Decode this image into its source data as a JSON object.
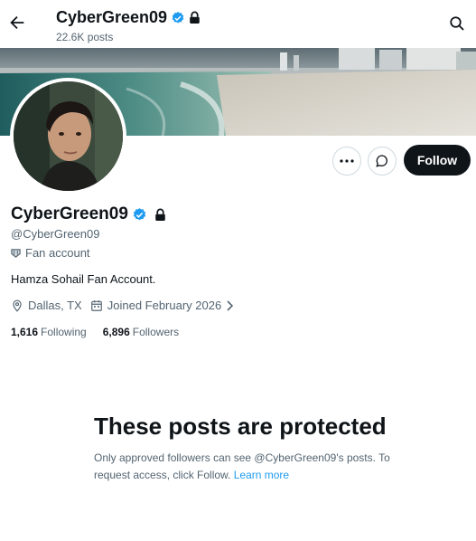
{
  "header": {
    "name": "CyberGreen09",
    "post_count": "22.6K posts"
  },
  "profile": {
    "display_name": "CyberGreen09",
    "handle": "@CyberGreen09",
    "label": "Fan account",
    "bio": "Hamza Sohail Fan Account.",
    "location": "Dallas, TX",
    "joined": "Joined February 2026",
    "following_count": "1,616",
    "following_label": "Following",
    "followers_count": "6,896",
    "followers_label": "Followers"
  },
  "actions": {
    "follow_label": "Follow"
  },
  "protected_notice": {
    "title": "These posts are protected",
    "body": "Only approved followers can see @CyberGreen09's posts. To request access, click Follow.",
    "link": "Learn more"
  },
  "colors": {
    "accent": "#1d9bf0",
    "text": "#0f1419",
    "muted": "#536471"
  }
}
